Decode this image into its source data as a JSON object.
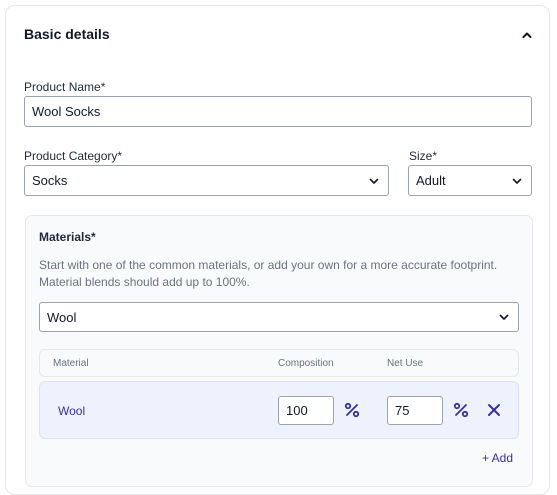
{
  "section": {
    "title": "Basic details",
    "collapse_icon": "chevron-up-icon"
  },
  "product_name": {
    "label": "Product Name*",
    "value": "Wool Socks"
  },
  "product_category": {
    "label": "Product Category*",
    "value": "Socks"
  },
  "size": {
    "label": "Size*",
    "value": "Adult"
  },
  "materials": {
    "label": "Materials*",
    "help_line1": "Start with one of the common materials, or add your own for a more accurate footprint.",
    "help_line2": "Material blends should add up to 100%.",
    "select_value": "Wool",
    "columns": [
      "Material",
      "Composition",
      "Net Use"
    ],
    "rows": [
      {
        "material": "Wool",
        "composition": "100",
        "net_use": "75"
      }
    ],
    "add_label": "+ Add"
  },
  "colors": {
    "accent": "#3730a3",
    "row_bg": "#eef2fd",
    "panel_bg": "#f9fafb"
  }
}
